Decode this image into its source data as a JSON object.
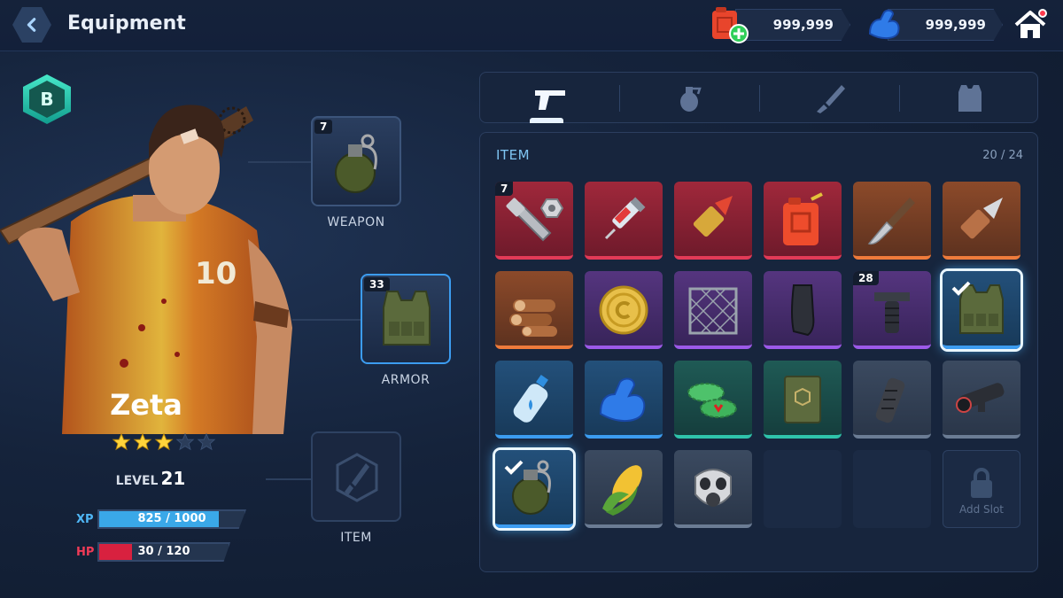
{
  "header": {
    "title": "Equipment",
    "resources": [
      {
        "icon": "fuel-can-plus-icon",
        "value": "999,999"
      },
      {
        "icon": "muscle-arm-icon",
        "value": "999,999"
      }
    ],
    "home_icon": "home-icon"
  },
  "hero": {
    "rank": "B",
    "name": "Zeta",
    "stars_filled": 3,
    "stars_total": 5,
    "level_label": "LEVEL",
    "level": "21",
    "xp_label": "XP",
    "xp_text": "825 / 1000",
    "xp_fraction": 0.825,
    "hp_label": "HP",
    "hp_text": "30 / 120",
    "hp_fraction": 0.25
  },
  "slots": {
    "weapon": {
      "label": "WEAPON",
      "count": "7",
      "icon": "grenade-icon"
    },
    "armor": {
      "label": "ARMOR",
      "count": "33",
      "icon": "vest-icon"
    },
    "item": {
      "label": "ITEM",
      "icon": "knife-icon"
    }
  },
  "tabs": [
    {
      "name": "pistol-icon",
      "active": true
    },
    {
      "name": "grenade-icon",
      "active": false
    },
    {
      "name": "knife-icon",
      "active": false
    },
    {
      "name": "vest-icon",
      "active": false
    }
  ],
  "inventory": {
    "title": "ITEM",
    "count": "20 / 24",
    "add_slot_label": "Add Slot",
    "items": [
      {
        "icon": "bolt-nut-icon",
        "rarity": "red",
        "count": "7"
      },
      {
        "icon": "syringe-icon",
        "rarity": "red"
      },
      {
        "icon": "bullet-icon",
        "rarity": "red"
      },
      {
        "icon": "fuel-can-icon",
        "rarity": "red"
      },
      {
        "icon": "combat-knife-icon",
        "rarity": "orange"
      },
      {
        "icon": "shell-icon",
        "rarity": "orange"
      },
      {
        "icon": "logs-icon",
        "rarity": "orange"
      },
      {
        "icon": "coin-icon",
        "rarity": "purple"
      },
      {
        "icon": "fence-icon",
        "rarity": "purple"
      },
      {
        "icon": "magazine-icon",
        "rarity": "purple"
      },
      {
        "icon": "grip-icon",
        "rarity": "purple",
        "count": "28"
      },
      {
        "icon": "vest-icon",
        "rarity": "blue",
        "selected": true
      },
      {
        "icon": "water-bottle-icon",
        "rarity": "blue"
      },
      {
        "icon": "muscle-arm-icon",
        "rarity": "blue"
      },
      {
        "icon": "bottle-caps-icon",
        "rarity": "teal"
      },
      {
        "icon": "book-icon",
        "rarity": "teal"
      },
      {
        "icon": "suppressor-icon",
        "rarity": "gray"
      },
      {
        "icon": "scope-icon",
        "rarity": "gray"
      },
      {
        "icon": "grenade-icon",
        "rarity": "blue",
        "selected": true
      },
      {
        "icon": "corn-icon",
        "rarity": "gray"
      },
      {
        "icon": "gas-mask-icon",
        "rarity": "gray"
      }
    ]
  }
}
